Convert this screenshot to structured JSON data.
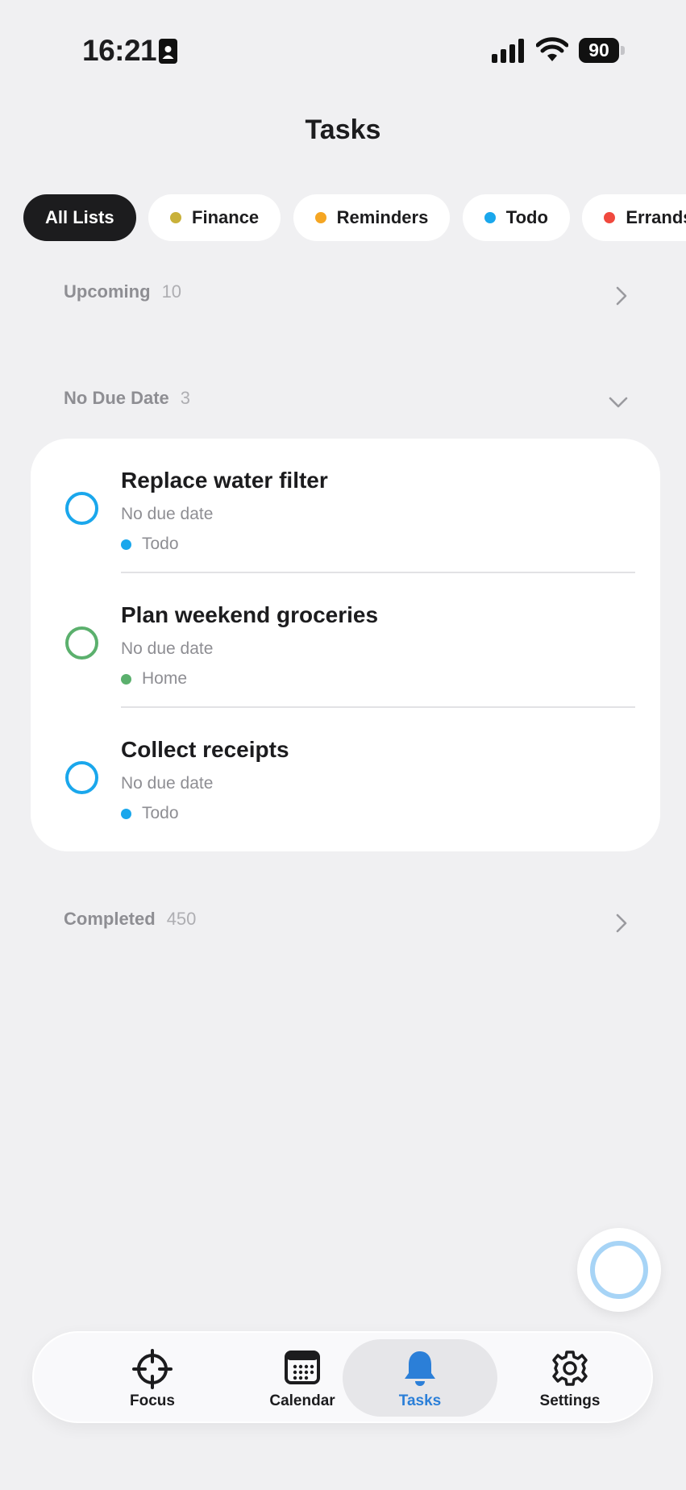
{
  "status_bar": {
    "time": "16:21",
    "battery": "90"
  },
  "title": "Tasks",
  "filters": [
    {
      "label": "All Lists",
      "active": true
    },
    {
      "label": "Finance",
      "color": "#c9b13a"
    },
    {
      "label": "Reminders",
      "color": "#f5a623"
    },
    {
      "label": "Todo",
      "color": "#1aa7ec"
    },
    {
      "label": "Errands",
      "color": "#f0493e"
    }
  ],
  "sections": {
    "upcoming": {
      "label": "Upcoming",
      "count": "10"
    },
    "no_due_date": {
      "label": "No Due Date",
      "count": "3"
    },
    "completed": {
      "label": "Completed",
      "count": "450"
    }
  },
  "tasks": [
    {
      "title": "Replace water filter",
      "due": "No due date",
      "list": "Todo",
      "color": "#1aa7ec"
    },
    {
      "title": "Plan weekend groceries",
      "due": "No due date",
      "list": "Home",
      "color": "#5bb06d"
    },
    {
      "title": "Collect receipts",
      "due": "No due date",
      "list": "Todo",
      "color": "#1aa7ec"
    }
  ],
  "nav": [
    {
      "label": "Focus",
      "icon": "crosshair-icon"
    },
    {
      "label": "Calendar",
      "icon": "calendar-icon"
    },
    {
      "label": "Tasks",
      "icon": "bell-icon",
      "active": true
    },
    {
      "label": "Settings",
      "icon": "gear-icon"
    }
  ],
  "colors": {
    "accent": "#2b7fd8",
    "background": "#f0f0f2",
    "chip_active": "#1c1c1e"
  }
}
